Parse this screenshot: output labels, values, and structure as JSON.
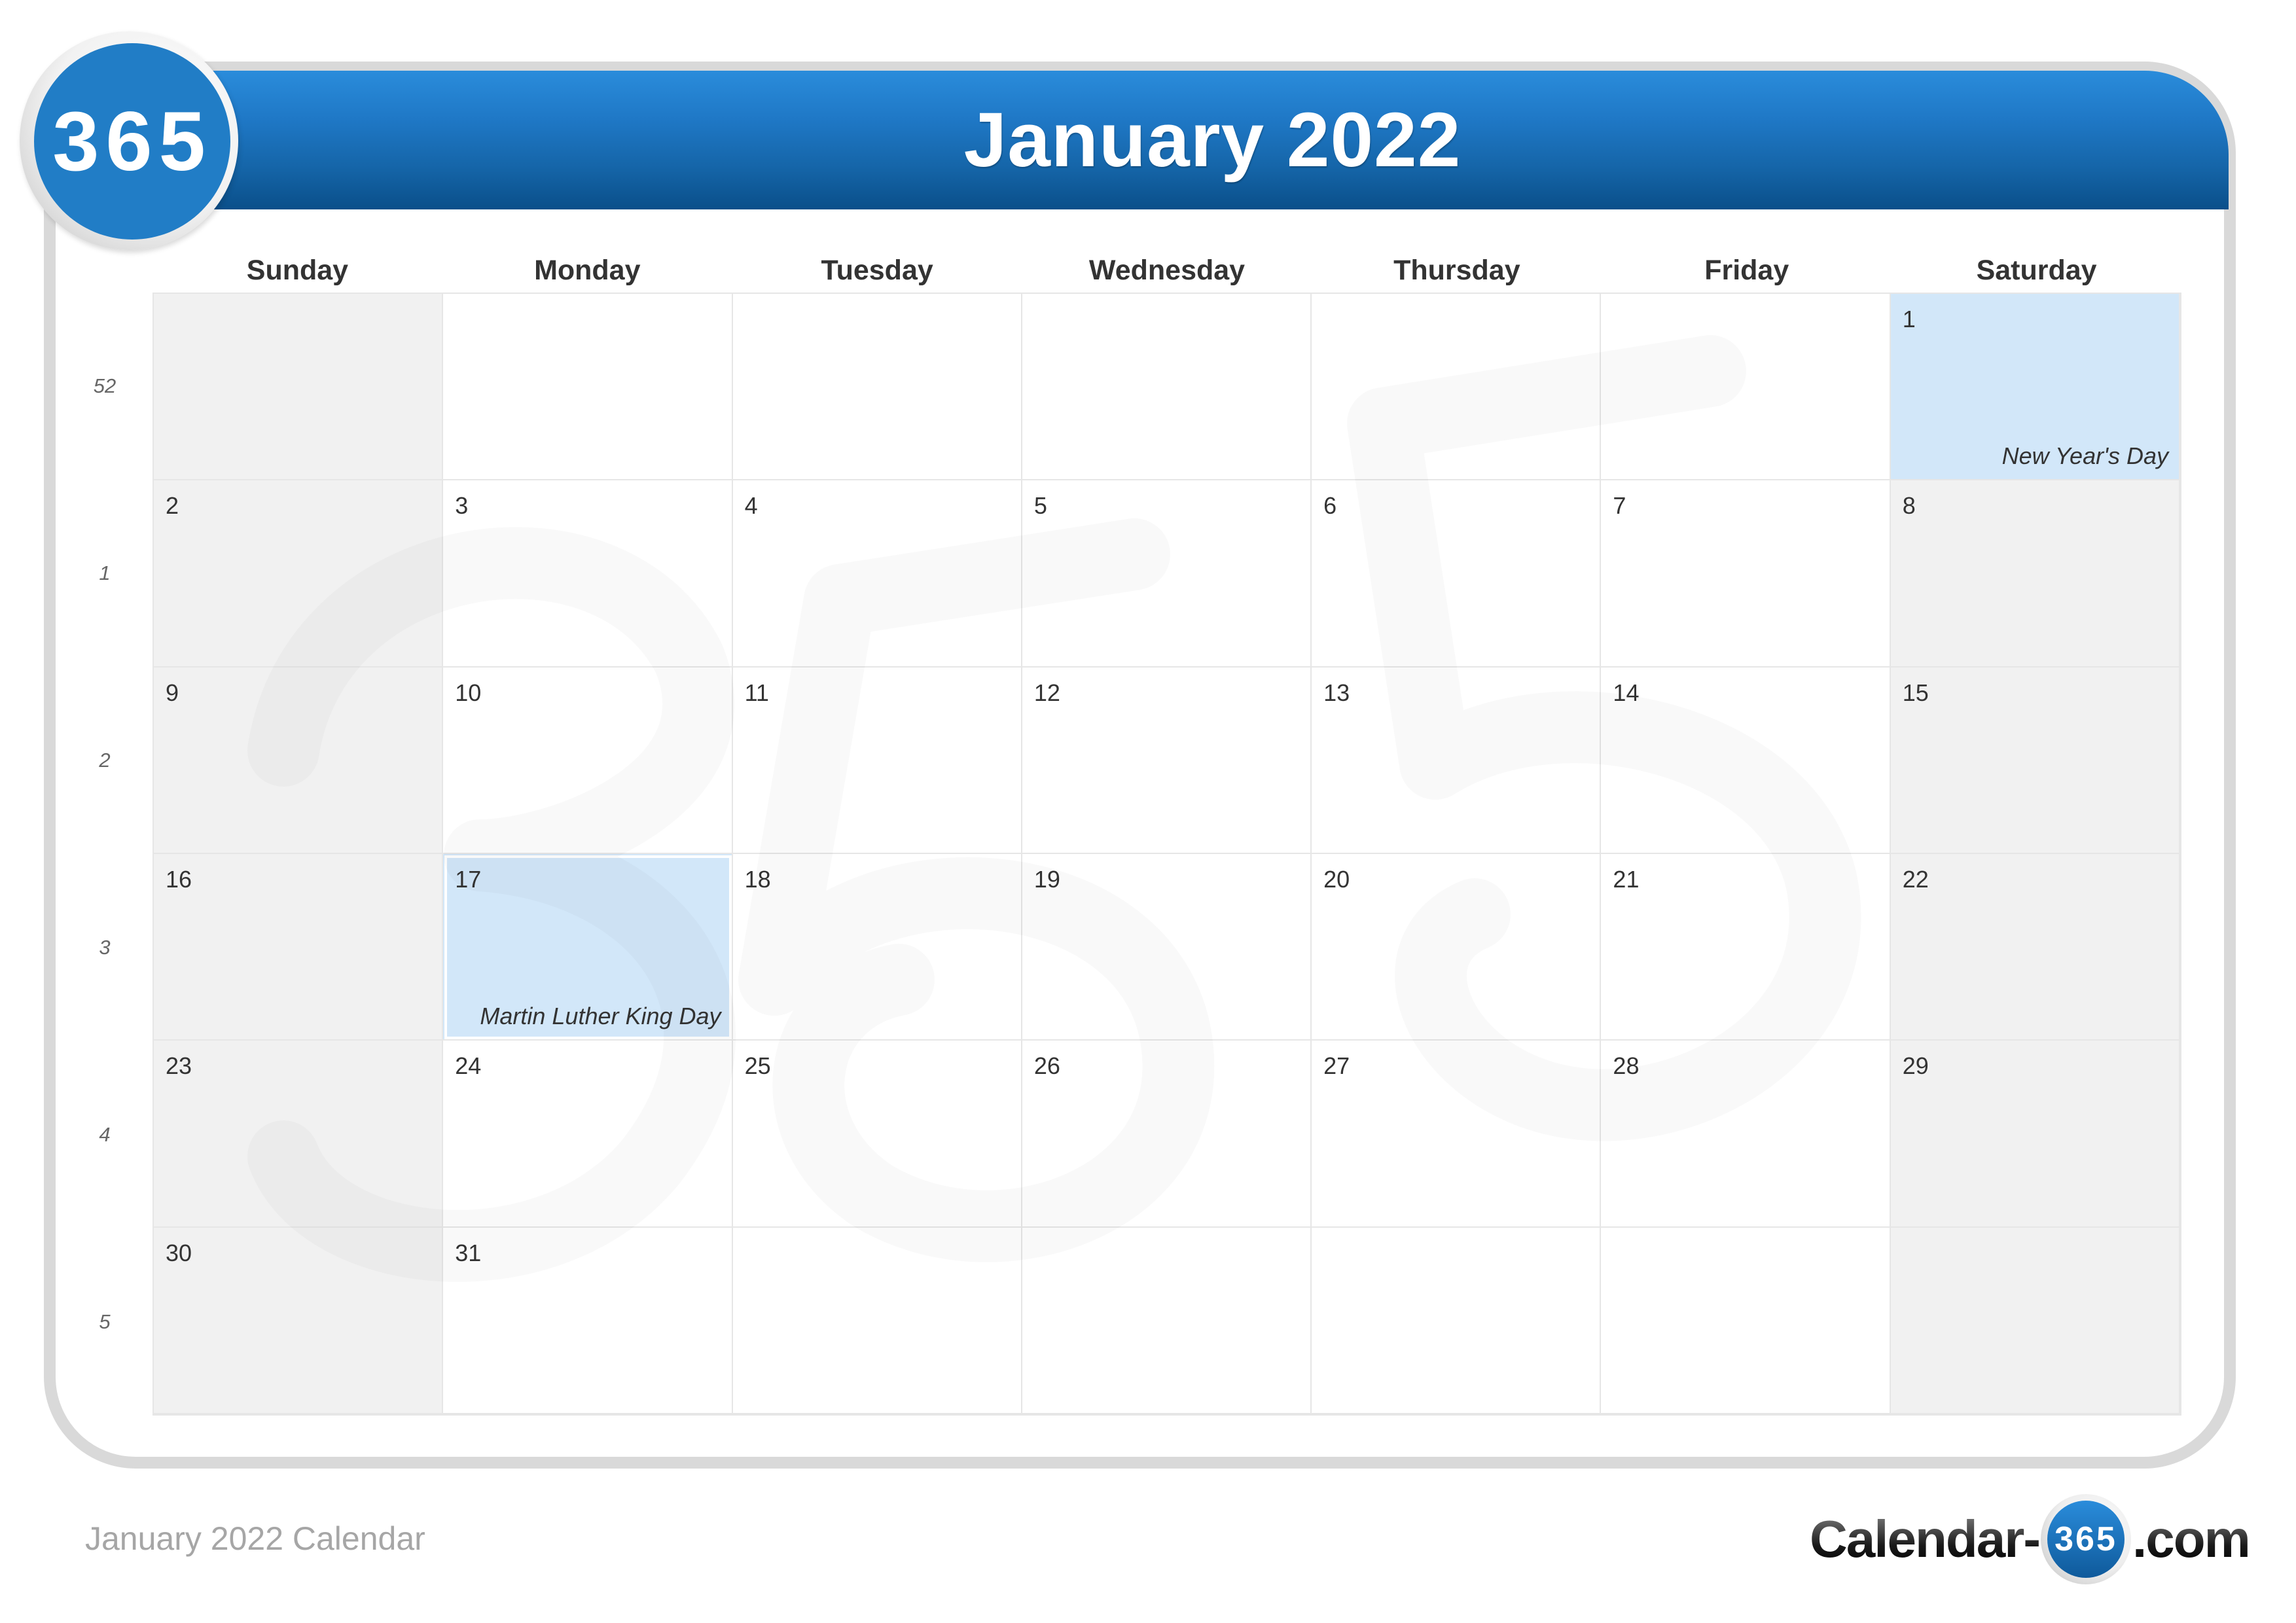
{
  "header": {
    "title": "January 2022",
    "logo_text": "365"
  },
  "colors": {
    "header_blue_top": "#2a8cdb",
    "header_blue_bottom": "#0a4f8a",
    "holiday_fill": "#d2e7f9",
    "weekend_fill": "#f0f0f0",
    "frame_border": "#d9d9d9"
  },
  "weekdays": [
    "Sunday",
    "Monday",
    "Tuesday",
    "Wednesday",
    "Thursday",
    "Friday",
    "Saturday"
  ],
  "week_numbers": [
    "52",
    "1",
    "2",
    "3",
    "4",
    "5"
  ],
  "weeks": [
    [
      {
        "day": ""
      },
      {
        "day": ""
      },
      {
        "day": ""
      },
      {
        "day": ""
      },
      {
        "day": ""
      },
      {
        "day": ""
      },
      {
        "day": "1",
        "event": "New Year's Day"
      }
    ],
    [
      {
        "day": "2"
      },
      {
        "day": "3"
      },
      {
        "day": "4"
      },
      {
        "day": "5"
      },
      {
        "day": "6"
      },
      {
        "day": "7"
      },
      {
        "day": "8"
      }
    ],
    [
      {
        "day": "9"
      },
      {
        "day": "10"
      },
      {
        "day": "11"
      },
      {
        "day": "12"
      },
      {
        "day": "13"
      },
      {
        "day": "14"
      },
      {
        "day": "15"
      }
    ],
    [
      {
        "day": "16"
      },
      {
        "day": "17",
        "event": "Martin Luther King Day"
      },
      {
        "day": "18"
      },
      {
        "day": "19"
      },
      {
        "day": "20"
      },
      {
        "day": "21"
      },
      {
        "day": "22"
      }
    ],
    [
      {
        "day": "23"
      },
      {
        "day": "24"
      },
      {
        "day": "25"
      },
      {
        "day": "26"
      },
      {
        "day": "27"
      },
      {
        "day": "28"
      },
      {
        "day": "29"
      }
    ],
    [
      {
        "day": "30"
      },
      {
        "day": "31"
      },
      {
        "day": ""
      },
      {
        "day": ""
      },
      {
        "day": ""
      },
      {
        "day": ""
      },
      {
        "day": ""
      }
    ]
  ],
  "footer": {
    "title": "January 2022 Calendar",
    "brand_prefix": "Calendar-",
    "brand_number": "365",
    "brand_suffix": ".com"
  }
}
